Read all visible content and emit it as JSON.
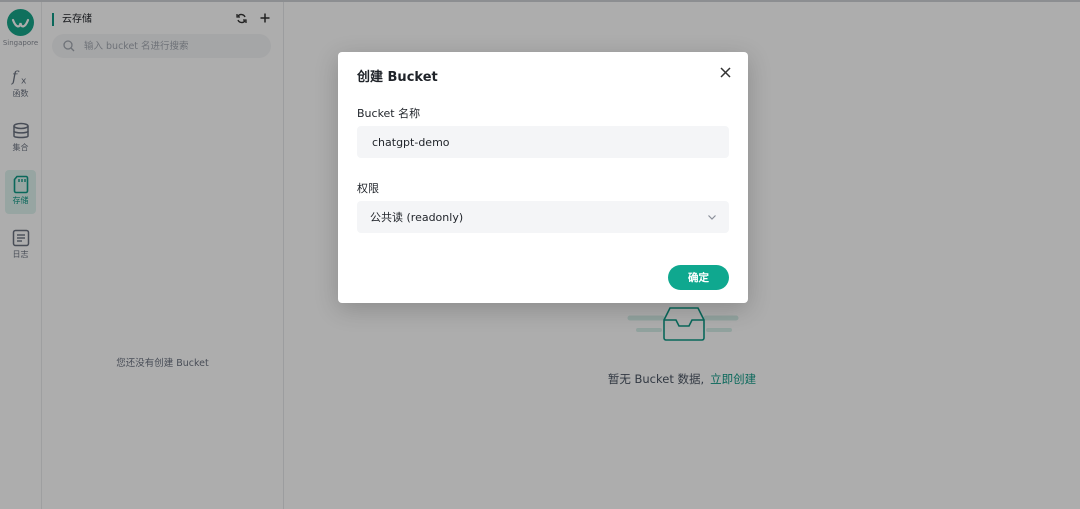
{
  "rail": {
    "region": "Singapore",
    "items": [
      {
        "label": "函数",
        "icon": "function-icon"
      },
      {
        "label": "集合",
        "icon": "database-icon"
      },
      {
        "label": "存储",
        "icon": "storage-icon",
        "active": true
      },
      {
        "label": "日志",
        "icon": "log-icon"
      }
    ]
  },
  "sidebar": {
    "title": "云存储",
    "search_placeholder": "输入 bucket 名进行搜索",
    "empty_text": "您还没有创建 Bucket"
  },
  "main": {
    "empty_text": "暂无 Bucket 数据,",
    "create_link": "立即创建"
  },
  "modal": {
    "title": "创建 Bucket",
    "name_label": "Bucket 名称",
    "name_value": "chatgpt-demo",
    "permission_label": "权限",
    "permission_value": "公共读 (readonly)",
    "confirm_label": "确定"
  },
  "colors": {
    "accent": "#0fa88f",
    "brand": "#17a589",
    "mask": "rgba(0,0,0,0.32)"
  }
}
